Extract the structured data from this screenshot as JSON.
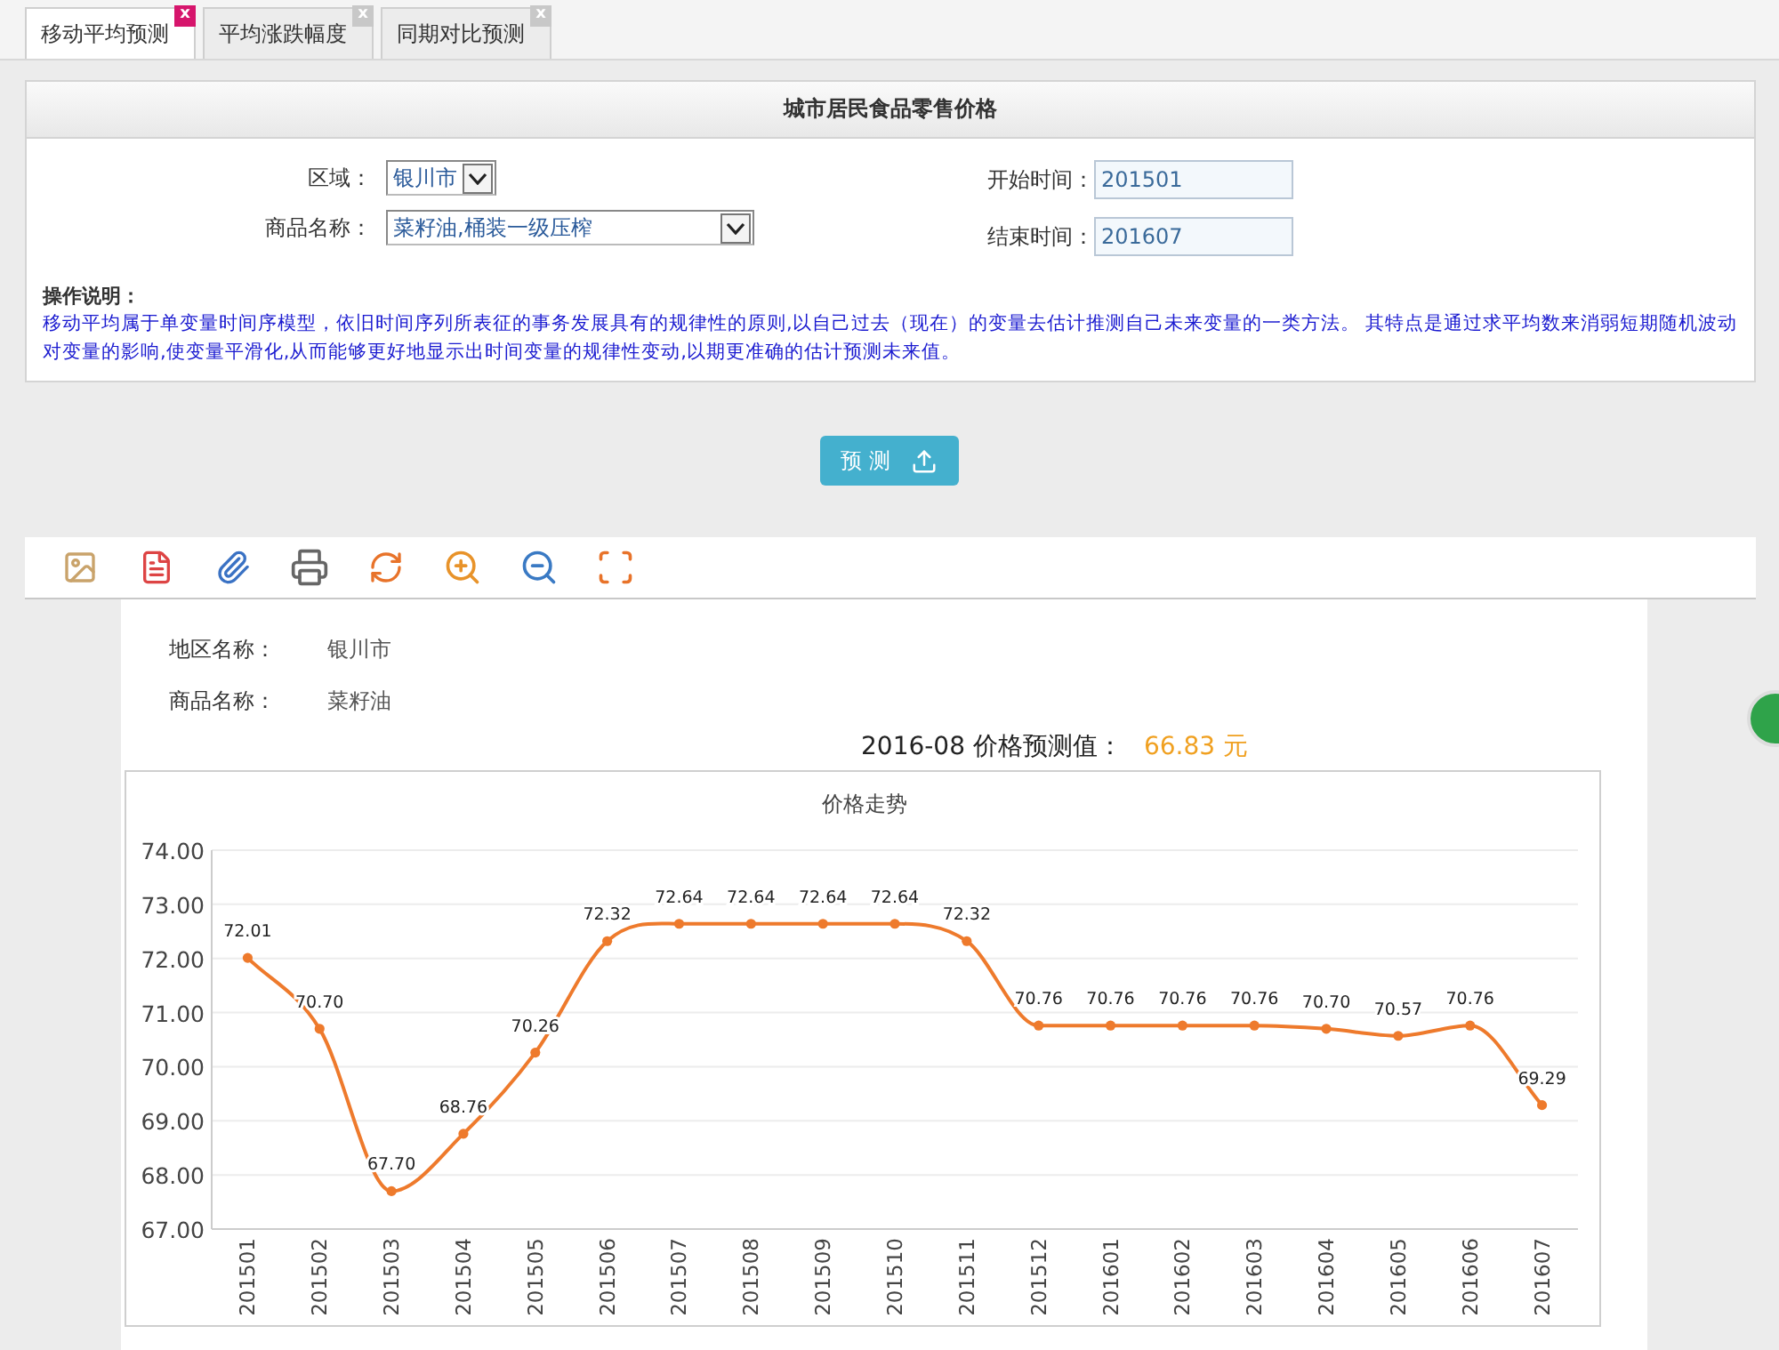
{
  "tabs": [
    {
      "label": "移动平均预测",
      "selected": true,
      "close": "x"
    },
    {
      "label": "平均涨跌幅度",
      "selected": false,
      "close": "x"
    },
    {
      "label": "同期对比预测",
      "selected": false,
      "close": "x"
    }
  ],
  "panel": {
    "title": "城市居民食品零售价格",
    "fields": [
      {
        "label": "区域：",
        "value": "银川市",
        "kind": "select"
      },
      {
        "label": "商品名称：",
        "value": "菜籽油,桶装一级压榨",
        "kind": "select"
      }
    ],
    "dates": [
      {
        "label": "开始时间：",
        "value": "201501"
      },
      {
        "label": "结束时间：",
        "value": "201607"
      }
    ],
    "note_title": "操作说明：",
    "note_text": "移动平均属于单变量时间序模型，依旧时间序列所表征的事务发展具有的规律性的原则,以自己过去（现在）的变量去估计推测自己未来变量的一类方法。 其特点是通过求平均数来消弱短期随机波动对变量的影响,使变量平滑化,从而能够更好地显示出时间变量的规律性变动,以期更准确的估计预测未来值。"
  },
  "predict_button": "预 测",
  "report": {
    "rows": [
      {
        "label": "地区名称：",
        "value": "银川市"
      },
      {
        "label": "商品名称：",
        "value": "菜籽油"
      }
    ],
    "forecast_label": "2016-08 价格预测值：",
    "forecast_value": "66.83 元",
    "chart_data": {
      "type": "line",
      "title": "价格走势",
      "categories": [
        "201501",
        "201502",
        "201503",
        "201504",
        "201505",
        "201506",
        "201507",
        "201508",
        "201509",
        "201510",
        "201511",
        "201512",
        "201601",
        "201602",
        "201603",
        "201604",
        "201605",
        "201606",
        "201607"
      ],
      "series": [
        {
          "color": "#ee7a2c",
          "values": [
            72.01,
            70.7,
            67.7,
            68.76,
            70.26,
            72.32,
            72.64,
            72.64,
            72.64,
            72.64,
            72.32,
            70.76,
            70.76,
            70.76,
            70.76,
            70.7,
            70.57,
            70.76,
            69.29
          ]
        }
      ],
      "ylim": [
        67,
        74
      ],
      "yticks": [
        {
          "value": 67,
          "label": "67.00"
        },
        {
          "value": 68,
          "label": "68.00"
        },
        {
          "value": 69,
          "label": "69.00"
        },
        {
          "value": 70,
          "label": "70.00"
        },
        {
          "value": 71,
          "label": "71.00"
        },
        {
          "value": 72,
          "label": "72.00"
        },
        {
          "value": 73,
          "label": "73.00"
        },
        {
          "value": 74,
          "label": "74.00"
        }
      ],
      "value_labels": [
        "72.01",
        "70.70",
        "67.70",
        "68.76",
        "70.26",
        "72.32",
        "72.64",
        "72.64",
        "72.64",
        "72.64",
        "72.32",
        "70.76",
        "70.76",
        "70.76",
        "70.76",
        "70.70",
        "70.57",
        "70.76",
        "69.29"
      ],
      "grid": true,
      "marker": true
    }
  }
}
